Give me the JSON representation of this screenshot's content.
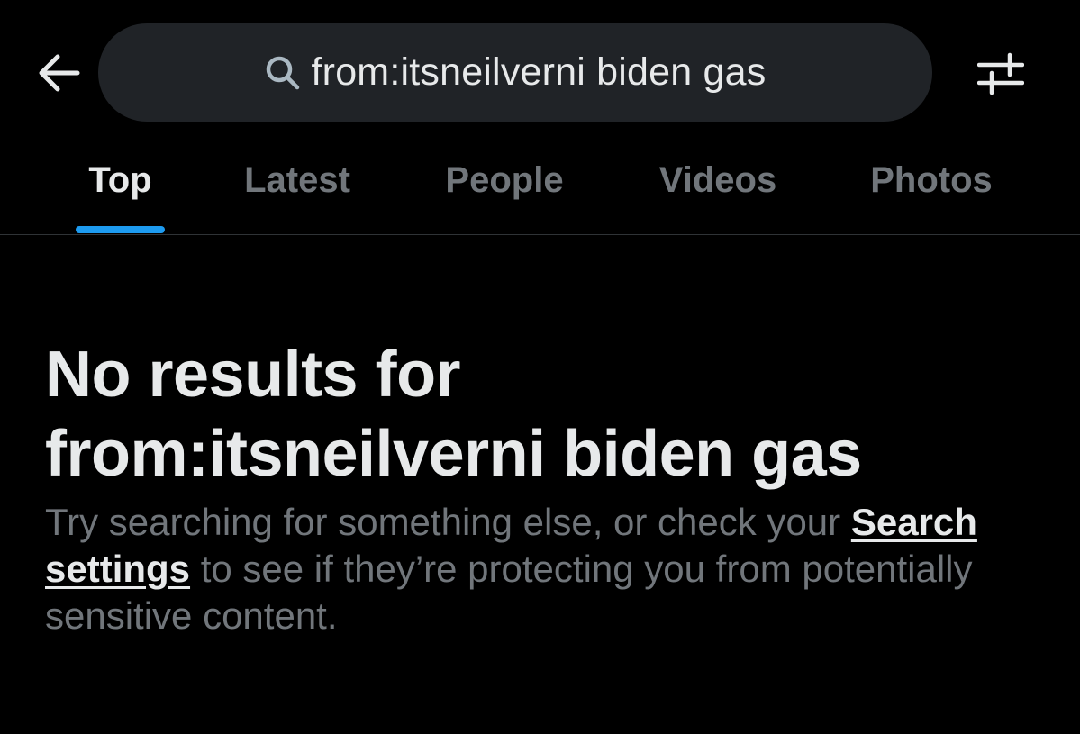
{
  "header": {
    "back_icon": "arrow-left-icon",
    "search": {
      "icon": "search-icon",
      "query": "from:itsneilverni biden gas"
    },
    "filter_icon": "sliders-icon"
  },
  "tabs": [
    {
      "label": "Top",
      "active": true
    },
    {
      "label": "Latest",
      "active": false
    },
    {
      "label": "People",
      "active": false
    },
    {
      "label": "Videos",
      "active": false
    },
    {
      "label": "Photos",
      "active": false
    }
  ],
  "empty_state": {
    "title_line1": "No results for",
    "title_line2": "from:itsneilverni biden gas",
    "body_prefix": "Try searching for something else, or check your ",
    "body_link": "Search settings",
    "body_suffix": " to see if they’re protecting you from potentially sensitive content."
  },
  "colors": {
    "background": "#000000",
    "accent": "#1d9bf0",
    "primary_text": "#e7e9ea",
    "secondary_text": "#71767b",
    "search_bg": "#202327"
  }
}
